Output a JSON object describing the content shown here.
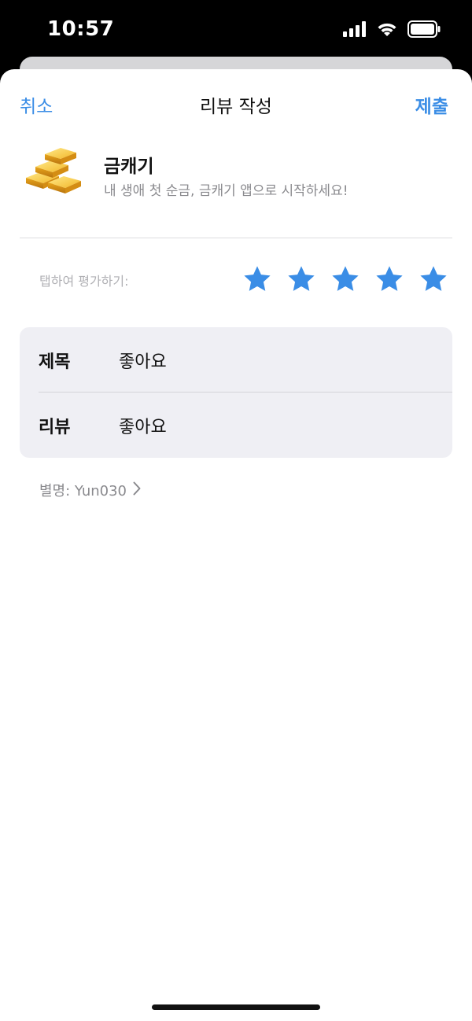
{
  "status_bar": {
    "time": "10:57",
    "icons": [
      "signal-icon",
      "wifi-icon",
      "battery-icon"
    ]
  },
  "nav": {
    "cancel_label": "취소",
    "title": "리뷰 작성",
    "submit_label": "제출"
  },
  "app": {
    "icon": "gold-bars-icon",
    "name": "금캐기",
    "subtitle": "내 생애 첫 순금, 금캐기 앱으로 시작하세요!"
  },
  "rating": {
    "label": "탭하여 평가하기:",
    "value": 5,
    "max": 5,
    "star_color": "#3a8de6"
  },
  "form": {
    "title_label": "제목",
    "title_value": "좋아요",
    "review_label": "리뷰",
    "review_value": "좋아요"
  },
  "nickname": {
    "text": "별명: Yun030",
    "chevron": "chevron-right-icon"
  },
  "colors": {
    "accent": "#3a8de6",
    "form_background": "#efeff4",
    "secondary_text": "#8a8a8e"
  }
}
